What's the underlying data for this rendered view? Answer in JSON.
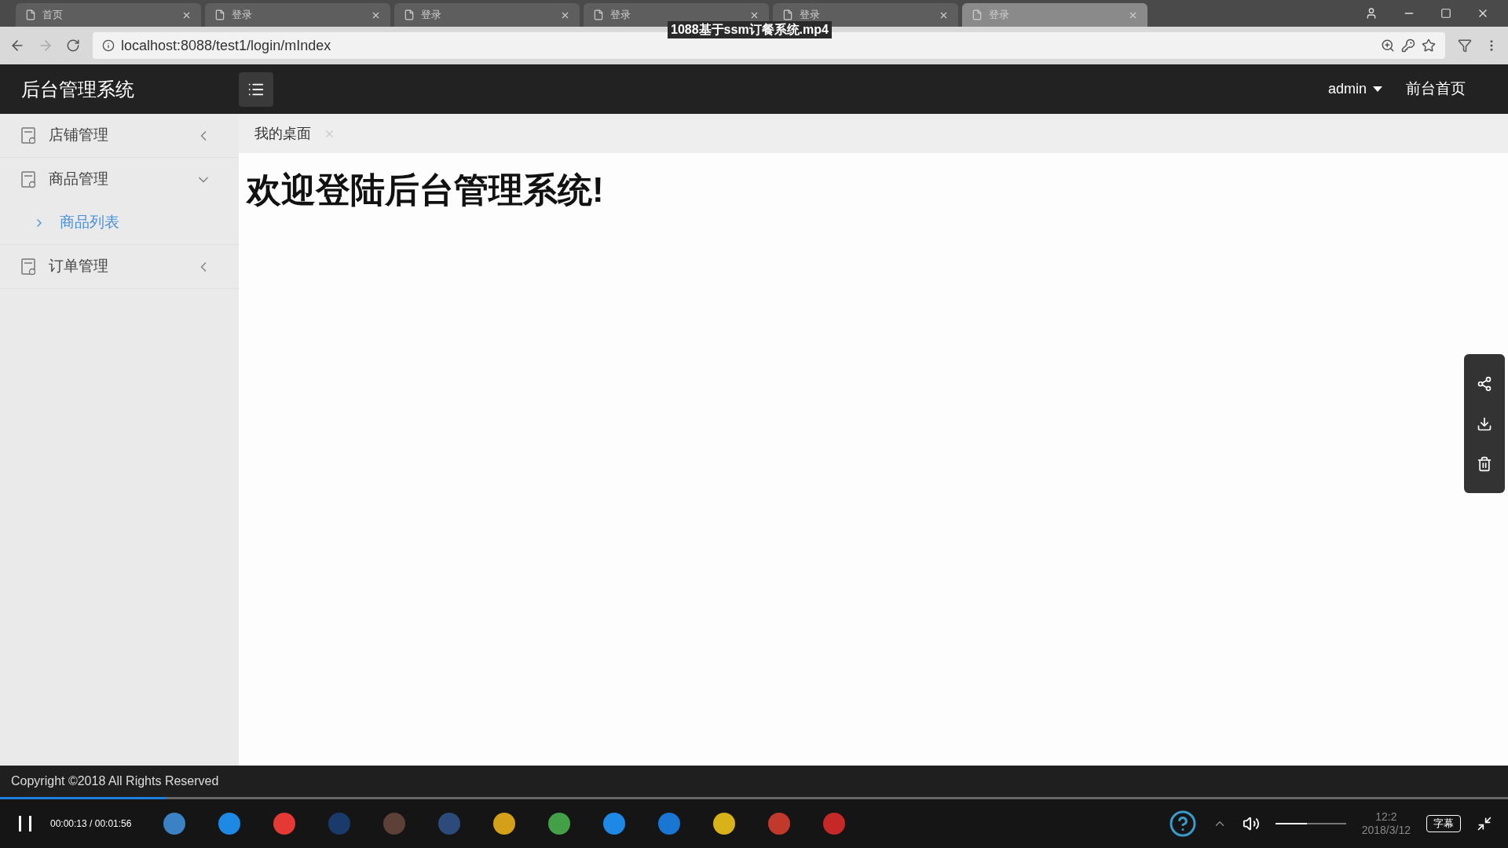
{
  "video_title": "1088基于ssm订餐系统.mp4",
  "browser": {
    "tabs": [
      {
        "label": "首页",
        "selected": false
      },
      {
        "label": "登录",
        "selected": false
      },
      {
        "label": "登录",
        "selected": false
      },
      {
        "label": "登录",
        "selected": false
      },
      {
        "label": "登录",
        "selected": false
      },
      {
        "label": "登录",
        "selected": true
      }
    ],
    "url": "localhost:8088/test1/login/mIndex"
  },
  "header": {
    "title": "后台管理系统",
    "user": "admin",
    "front_link": "前台首页"
  },
  "sidebar": {
    "items": [
      {
        "label": "店铺管理",
        "expanded": false
      },
      {
        "label": "商品管理",
        "expanded": true,
        "children": [
          {
            "label": "商品列表",
            "selected": true
          }
        ]
      },
      {
        "label": "订单管理",
        "expanded": false
      }
    ]
  },
  "content_tabs": [
    {
      "label": "我的桌面",
      "selected": true
    }
  ],
  "welcome": "欢迎登陆后台管理系统!",
  "footer": "Copyright ©2018 All Rights Reserved",
  "player": {
    "progress": {
      "level": 0.11
    },
    "time": "00:00:13 / 00:01:56",
    "volume": {
      "level": 0.45
    },
    "subtitle_button": "字幕",
    "clock_time": "12:2",
    "clock_date": "2018/3/12"
  }
}
